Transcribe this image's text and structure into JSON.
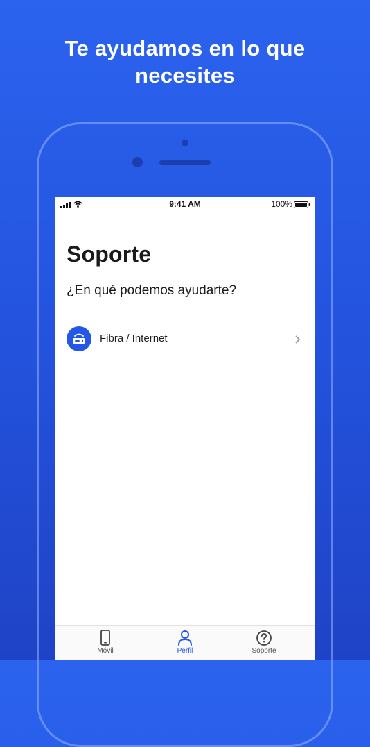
{
  "headline": {
    "line1": "Te ayudamos en lo que",
    "line2": "necesites"
  },
  "status_bar": {
    "time": "9:41 AM",
    "battery": "100%",
    "icons": [
      "signal-icon",
      "wifi-icon",
      "battery-icon"
    ]
  },
  "page": {
    "title": "Soporte",
    "subtitle": "¿En qué podemos ayudarte?"
  },
  "support_options": [
    {
      "label": "Fibra / Internet",
      "icon": "router-icon"
    }
  ],
  "tab_bar": {
    "items": [
      {
        "label": "Móvil",
        "icon": "phone-icon",
        "active": false
      },
      {
        "label": "Perfil",
        "icon": "user-icon",
        "active": true
      },
      {
        "label": "Soporte",
        "icon": "help-icon",
        "active": false
      }
    ]
  },
  "colors": {
    "brand_blue": "#2557e6",
    "background_top": "#2b63ee",
    "background_bottom": "#1f43c6"
  }
}
